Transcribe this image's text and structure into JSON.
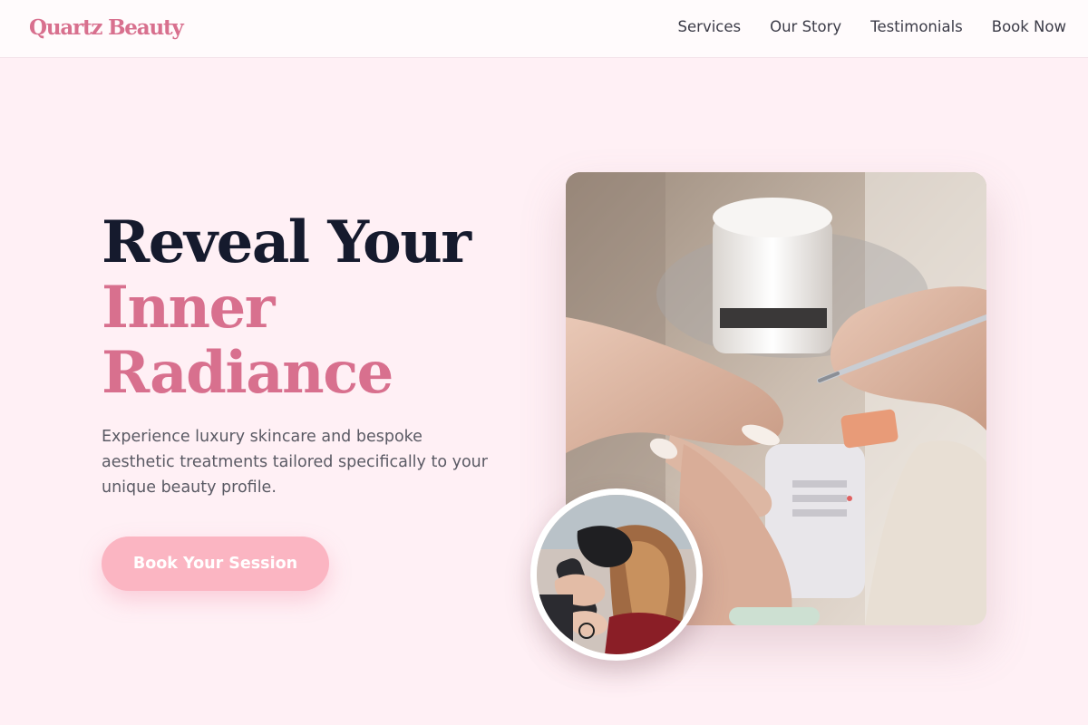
{
  "brand": {
    "name": "Quartz Beauty"
  },
  "nav": {
    "items": [
      "Services",
      "Our Story",
      "Testimonials",
      "Book Now"
    ]
  },
  "hero": {
    "headline_line1": "Reveal Your",
    "headline_line2": "Inner",
    "headline_line3": "Radiance",
    "subtext": "Experience luxury skincare and bespoke aesthetic treatments tailored specifically to your unique beauty profile.",
    "cta_label": "Book Your Session"
  },
  "colors": {
    "accent_pink": "#d8708e",
    "button_pink": "#fbb5c2",
    "background": "#fff0f5",
    "headline_dark": "#151a2d"
  },
  "images": {
    "main": "manicure-photo",
    "circle": "hair-styling-photo"
  }
}
